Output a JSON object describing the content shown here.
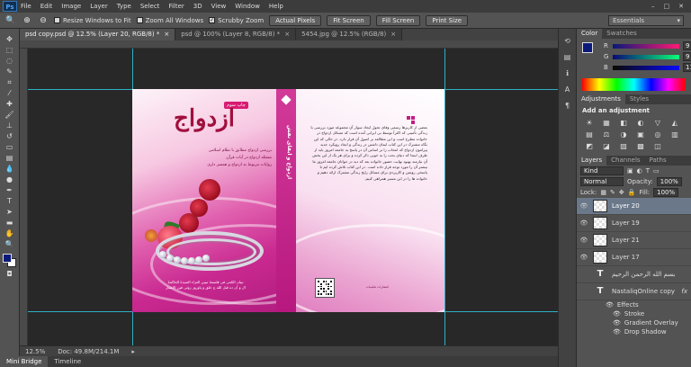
{
  "app": {
    "logo": "Ps"
  },
  "menu": [
    "File",
    "Edit",
    "Image",
    "Layer",
    "Type",
    "Select",
    "Filter",
    "3D",
    "View",
    "Window",
    "Help"
  ],
  "window_controls": [
    "–",
    "□",
    "✕"
  ],
  "options_bar": {
    "resize_windows": "Resize Windows to Fit",
    "zoom_all": "Zoom All Windows",
    "scrubby_zoom": "Scrubby Zoom",
    "actual_pixels": "Actual Pixels",
    "fit_screen": "Fit Screen",
    "fill_screen": "Fill Screen",
    "print_size": "Print Size",
    "workspace": "Essentials"
  },
  "doc_tabs": [
    {
      "label": "psd copy.psd @ 12.5% (Layer 20, RGB/8) *",
      "active": true
    },
    {
      "label": "psd @ 100% (Layer 8, RGB/8) *",
      "active": false
    },
    {
      "label": "5454.jpg @ 12.5% (RGB/8)",
      "active": false
    }
  ],
  "book": {
    "front": {
      "title": "ازدواج",
      "tag": "چاپ سوم",
      "lines": [
        "بررسی ازدواج مطابق با نظام اسلامی",
        "مسئله ازدواج در آیات قرآن",
        "روایات مربوط به ازدواج و همسر داری"
      ],
      "bottom_lines": [
        "تبیان الکمی فی فلسفهٔ تبیین العزاء السیدهٔ الحاکمهٔ",
        "ال و آن ده قبل الله ج خلق و پاوروز زوئی قین الاعتبار"
      ]
    },
    "spine": {
      "title": "ازدواج و ایفای نفش"
    },
    "back": {
      "paragraph": "بعضی از کاربرها رسمی وفای تحول ایجاد سوار آن مجموعه مورد بررسی با زندگی تأمینی که اکثراً توسط بی ایرانی آمده است که مسائل ازدواج در خانواده مطرح است و این مطالعه بر اصول آن قرار دارد. در حالی که این نگاه مشترک در این کتاب ایمان داشتن در زندگی و ایجاد رویکرد جدید پیرامون ازدواج که انتخاب را بر اساس آن در پاسخ به جامعه امروز باید از طرف اینجا که دنیای بحث را به خوبی ذکر کرده و برای هر یک از این بخش آن نیازمند بهبود نهایت حضور خانواده بعد که دید در جوانان جامعه امروز ما بیشتر آن را مورد توجه قرار داده است. در این کتاب تلاش کرده ایم تا پاسخی روشن و کاربردی برای مسائل رایج زندگی مشترک ارائه دهیم و خانواده ها را در این مسیر همراهی کنیم.",
      "publisher": "انتشارات تعلیمات"
    }
  },
  "status": {
    "zoom": "12.5%",
    "doc": "Doc: 49.8M/214.1M"
  },
  "bottom_tabs": [
    "Mini Bridge",
    "Timeline"
  ],
  "color_panel": {
    "tabs": [
      "Color",
      "Swatches"
    ],
    "rows": [
      {
        "label": "R",
        "value": "9"
      },
      {
        "label": "G",
        "value": "9"
      },
      {
        "label": "B",
        "value": "119"
      }
    ]
  },
  "adjustments_panel": {
    "tabs": [
      "Adjustments",
      "Styles"
    ],
    "heading": "Add an adjustment",
    "icons": [
      "☀",
      "▦",
      "◧",
      "◐",
      "▽",
      "◭",
      "▤",
      "⚖",
      "◑",
      "▣",
      "◎",
      "▥",
      "◩",
      "◪",
      "▨",
      "▩",
      "◫"
    ]
  },
  "layers_panel": {
    "tabs": [
      "Layers",
      "Channels",
      "Paths"
    ],
    "filter": "Kind",
    "blend_mode": "Normal",
    "opacity_label": "Opacity:",
    "opacity": "100%",
    "lock_label": "Lock:",
    "fill_label": "Fill:",
    "fill": "100%",
    "layers": [
      {
        "name": "Layer 20",
        "selected": true,
        "type": "pixel"
      },
      {
        "name": "Layer 19",
        "selected": false,
        "type": "pixel"
      },
      {
        "name": "Layer 21",
        "selected": false,
        "type": "pixel"
      },
      {
        "name": "Layer 17",
        "selected": false,
        "type": "pixel"
      },
      {
        "name": "بسم الله الرحمن الرحیم",
        "selected": false,
        "type": "text"
      },
      {
        "name": "NastaliqOnline copy",
        "selected": false,
        "type": "text"
      }
    ],
    "effects_label": "Effects",
    "fx_badge": "fx",
    "effects": [
      "Stroke",
      "Gradient Overlay",
      "Drop Shadow"
    ]
  }
}
